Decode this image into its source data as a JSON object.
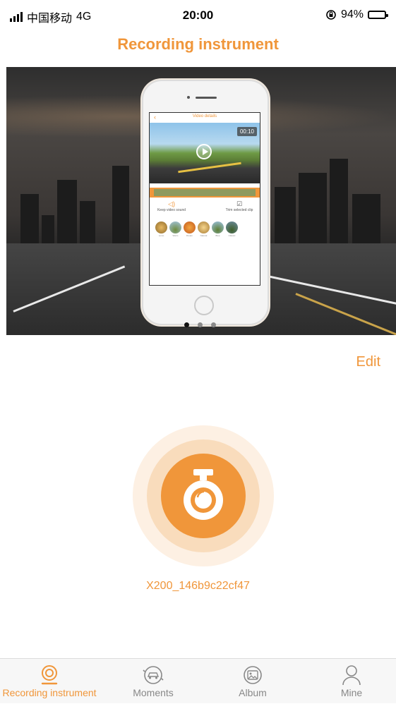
{
  "status_bar": {
    "carrier": "中国移动",
    "network": "4G",
    "time": "20:00",
    "battery_percent": "94%",
    "battery_level": 0.94
  },
  "header": {
    "title": "Recording instrument"
  },
  "banner": {
    "phone_screen": {
      "title": "Video details",
      "timestamp": "00:10",
      "option_left": "Keep video sound",
      "option_right": "Trim selected clip",
      "filter_labels": [
        "Lomo",
        "Warm",
        "Dream",
        "Natural",
        "Blue",
        "Classic"
      ]
    },
    "page_count": 3,
    "active_page": 1
  },
  "edit_label": "Edit",
  "device": {
    "name": "X200_146b9c22cf47",
    "icon": "dashcam-icon"
  },
  "tab_bar": {
    "tabs": [
      {
        "label": "Recording instrument",
        "icon": "dashcam-tab-icon",
        "active": true
      },
      {
        "label": "Moments",
        "icon": "car-icon",
        "active": false
      },
      {
        "label": "Album",
        "icon": "photo-icon",
        "active": false
      },
      {
        "label": "Mine",
        "icon": "person-icon",
        "active": false
      }
    ]
  },
  "colors": {
    "accent": "#f0963a",
    "accent_light": "#f9dcbc",
    "accent_lighter": "#fdf0e3",
    "tab_inactive": "#888888"
  }
}
